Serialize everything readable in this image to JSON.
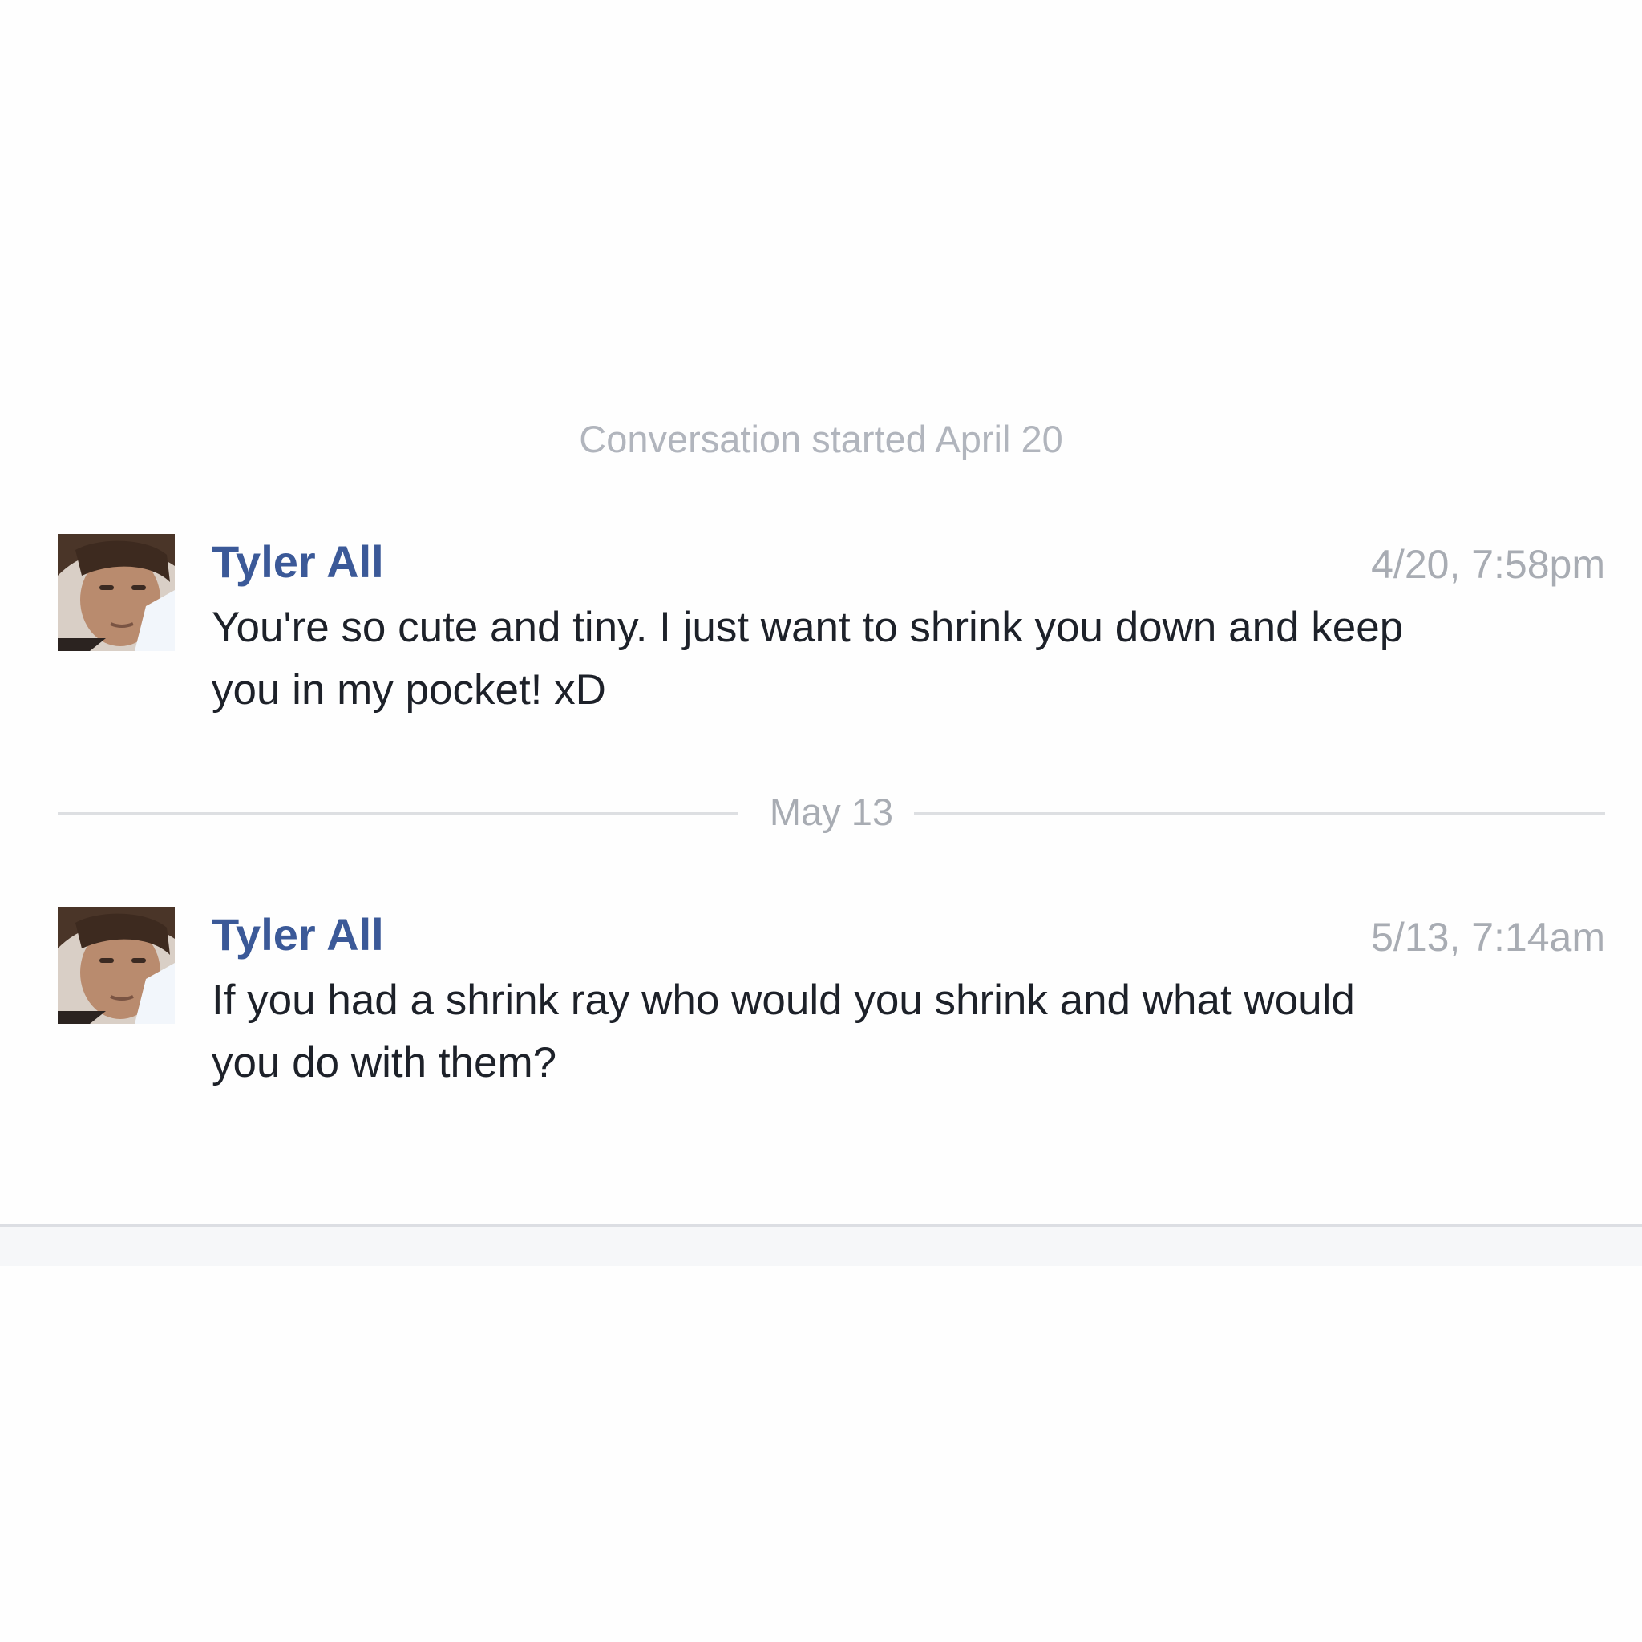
{
  "conversation": {
    "started_label": "Conversation started April 20",
    "date_divider": "May 13",
    "messages": [
      {
        "sender": "Tyler All",
        "timestamp": "4/20, 7:58pm",
        "text": "You're so cute and tiny. I just want to shrink you down and keep you in my pocket! xD"
      },
      {
        "sender": "Tyler All",
        "timestamp": "5/13, 7:14am",
        "text": "If you had a shrink ray who would you shrink and what would you do with them?"
      }
    ]
  },
  "colors": {
    "sender_name": "#3b5998",
    "message_text": "#1d2129",
    "meta_text": "#a8acb3",
    "divider_line": "#dddfe2",
    "background": "#fefefe"
  },
  "icons": {
    "avatar": "user-photo"
  }
}
